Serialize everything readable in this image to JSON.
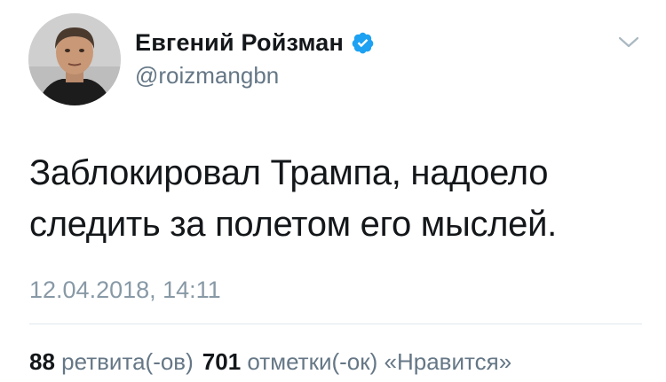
{
  "author": {
    "display_name": "Евгений Ройзман",
    "handle": "@roizmangbn",
    "verified": true,
    "avatar_icon": "user-avatar-photo"
  },
  "menu": {
    "icon": "chevron-down-icon"
  },
  "tweet": {
    "line1": "Заблокировал Трампа, надоело",
    "line2": "следить за полетом его мыслей.",
    "timestamp": "12.04.2018, 14:11"
  },
  "stats": {
    "retweets_count": "88",
    "retweets_label": "ретвита(-ов)",
    "likes_count": "701",
    "likes_label": "отметки(-ок) «Нравится»"
  },
  "colors": {
    "text": "#14171a",
    "secondary": "#657786",
    "timestamp": "#8899a6",
    "verified": "#1da1f2",
    "divider": "#e1e8ed"
  }
}
